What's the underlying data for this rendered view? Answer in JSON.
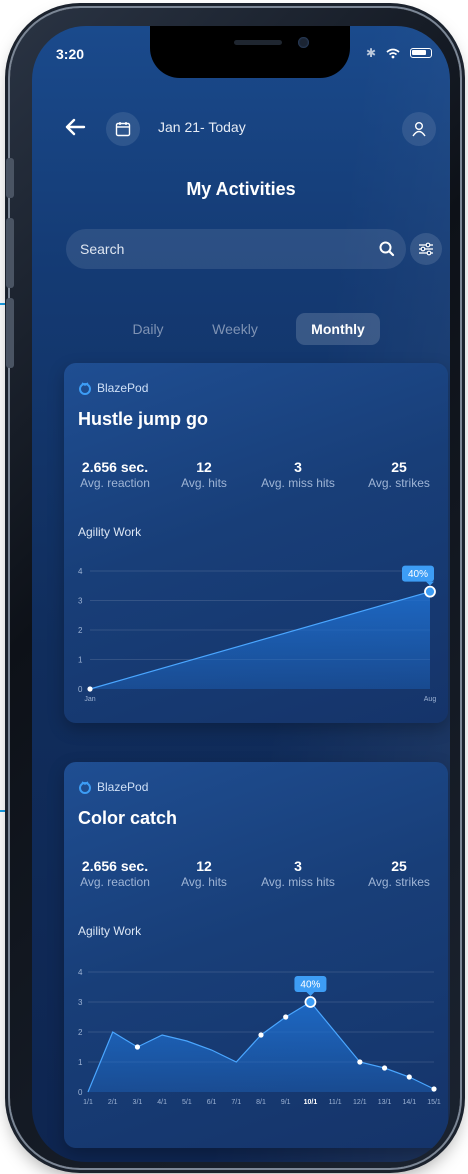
{
  "status_bar": {
    "time": "3:20"
  },
  "header": {
    "date_range": "Jan 21- Today",
    "title": "My Activities"
  },
  "search": {
    "placeholder": "Search"
  },
  "tabs": [
    {
      "label": "Daily",
      "active": false
    },
    {
      "label": "Weekly",
      "active": false
    },
    {
      "label": "Monthly",
      "active": true
    }
  ],
  "cards": [
    {
      "brand": "BlazePod",
      "title": "Hustle jump go",
      "stats": [
        {
          "value": "2.656 sec.",
          "label": "Avg. reaction"
        },
        {
          "value": "12",
          "label": "Avg. hits"
        },
        {
          "value": "3",
          "label": "Avg. miss hits"
        },
        {
          "value": "25",
          "label": "Avg. strikes"
        }
      ],
      "chart_label": "Agility Work",
      "chart_data": {
        "type": "area",
        "title": "Agility Work",
        "x": [
          "Jan",
          "Aug"
        ],
        "values": [
          0,
          3.3
        ],
        "ylim": [
          0,
          4
        ],
        "yticks": [
          "0",
          "1",
          "2",
          "3",
          "4"
        ],
        "highlight": {
          "index": 1,
          "label": "40%"
        },
        "grid": true,
        "color": "#1e6fd0"
      }
    },
    {
      "brand": "BlazePod",
      "title": "Color catch",
      "stats": [
        {
          "value": "2.656 sec.",
          "label": "Avg. reaction"
        },
        {
          "value": "12",
          "label": "Avg. hits"
        },
        {
          "value": "3",
          "label": "Avg. miss hits"
        },
        {
          "value": "25",
          "label": "Avg. strikes"
        }
      ],
      "chart_label": "Agility Work",
      "chart_data": {
        "type": "area",
        "title": "Agility Work",
        "x": [
          "1/1",
          "2/1",
          "3/1",
          "4/1",
          "5/1",
          "6/1",
          "7/1",
          "8/1",
          "9/1",
          "10/1",
          "11/1",
          "12/1",
          "13/1",
          "14/1",
          "15/1"
        ],
        "values": [
          0,
          2.0,
          1.5,
          1.9,
          1.7,
          1.4,
          1.0,
          1.9,
          2.5,
          3.0,
          2.0,
          1.0,
          0.8,
          0.5,
          0.1
        ],
        "markers": [
          false,
          false,
          true,
          false,
          false,
          false,
          false,
          true,
          true,
          true,
          false,
          true,
          true,
          true,
          true
        ],
        "ylim": [
          0,
          4
        ],
        "yticks": [
          "0",
          "1",
          "2",
          "3",
          "4"
        ],
        "highlight": {
          "index": 9,
          "label": "40%"
        },
        "bold_tick": "10/1",
        "grid": true,
        "color": "#1e6fd0"
      }
    }
  ],
  "colors": {
    "accent": "#3d9df5",
    "callout": "#1aa0e6"
  }
}
